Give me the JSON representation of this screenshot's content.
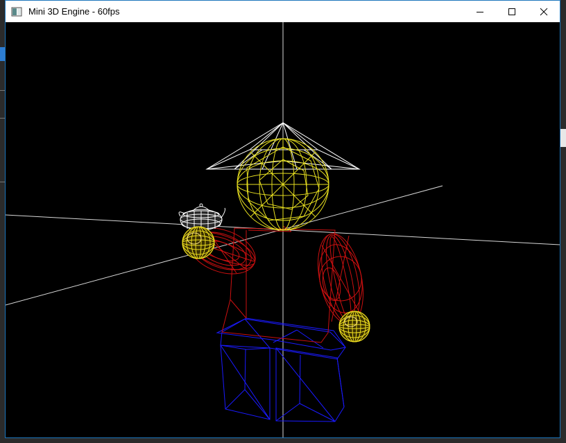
{
  "window": {
    "title": "Mini 3D Engine - 60fps",
    "app_icon": "window-app-icon",
    "controls": [
      "minimize-icon",
      "maximize-icon",
      "close-icon"
    ]
  },
  "scene": {
    "background": "#000000",
    "axis_color": "#d8d8d8",
    "colors": {
      "hat": "#ffffff",
      "head": "#e8e020",
      "torso": "#cc1010",
      "legs": "#1a1aff",
      "hands": "#f0e020",
      "teapot": "#ffffff"
    },
    "objects": [
      "axis-lines",
      "hat-cone",
      "head-sphere",
      "teapot",
      "left-hand-sphere",
      "left-arm-ellipsoid",
      "right-arm-ellipsoid",
      "right-hand-sphere",
      "torso",
      "legs"
    ]
  }
}
